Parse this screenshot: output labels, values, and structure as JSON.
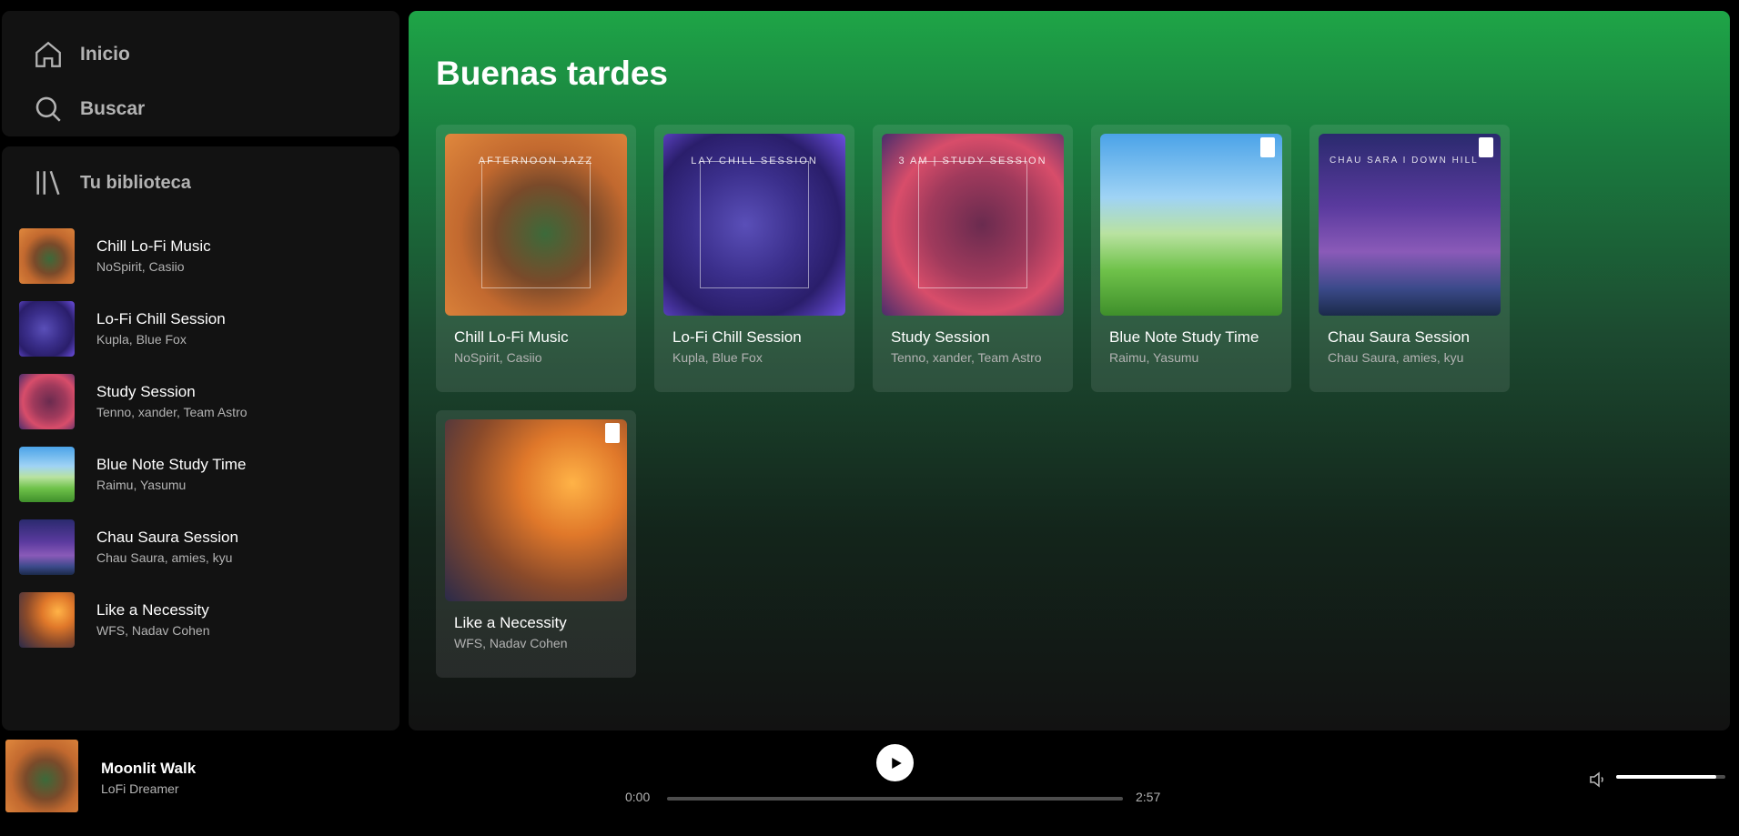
{
  "nav": {
    "items": [
      {
        "label": "Inicio",
        "icon": "home-icon"
      },
      {
        "label": "Buscar",
        "icon": "search-icon"
      }
    ]
  },
  "library": {
    "title": "Tu biblioteca",
    "items": [
      {
        "title": "Chill Lo-Fi Music",
        "artists": "NoSpirit, Casiio"
      },
      {
        "title": "Lo-Fi Chill Session",
        "artists": "Kupla, Blue Fox"
      },
      {
        "title": "Study Session",
        "artists": "Tenno, xander, Team Astro"
      },
      {
        "title": "Blue Note Study Time",
        "artists": "Raimu, Yasumu"
      },
      {
        "title": "Chau Saura Session",
        "artists": "Chau Saura, amies, kyu"
      },
      {
        "title": "Like a Necessity",
        "artists": "WFS, Nadav Cohen"
      }
    ]
  },
  "main": {
    "greeting": "Buenas tardes",
    "cards": [
      {
        "title": "Chill Lo-Fi Music",
        "artists": "NoSpirit, Casiio",
        "art_text": "AFTERNOON JAZZ"
      },
      {
        "title": "Lo-Fi Chill Session",
        "artists": "Kupla, Blue Fox",
        "art_text": "LAY CHILL SESSION"
      },
      {
        "title": "Study Session",
        "artists": "Tenno, xander, Team Astro",
        "art_text": "3 AM | STUDY SESSION"
      },
      {
        "title": "Blue Note Study Time",
        "artists": "Raimu, Yasumu",
        "art_text": ""
      },
      {
        "title": "Chau Saura Session",
        "artists": "Chau Saura, amies, kyu",
        "art_text": "CHAU SARA  I DOWN HILL"
      },
      {
        "title": "Like a Necessity",
        "artists": "WFS, Nadav Cohen",
        "art_text": ""
      }
    ]
  },
  "player": {
    "track_title": "Moonlit Walk",
    "track_artist": "LoFi Dreamer",
    "current_time": "0:00",
    "total_time": "2:57",
    "progress": 0,
    "volume": 0.92
  },
  "colors": {
    "accent": "#1ed760",
    "main_bg_top": "#1ea547",
    "panel": "#121212"
  }
}
